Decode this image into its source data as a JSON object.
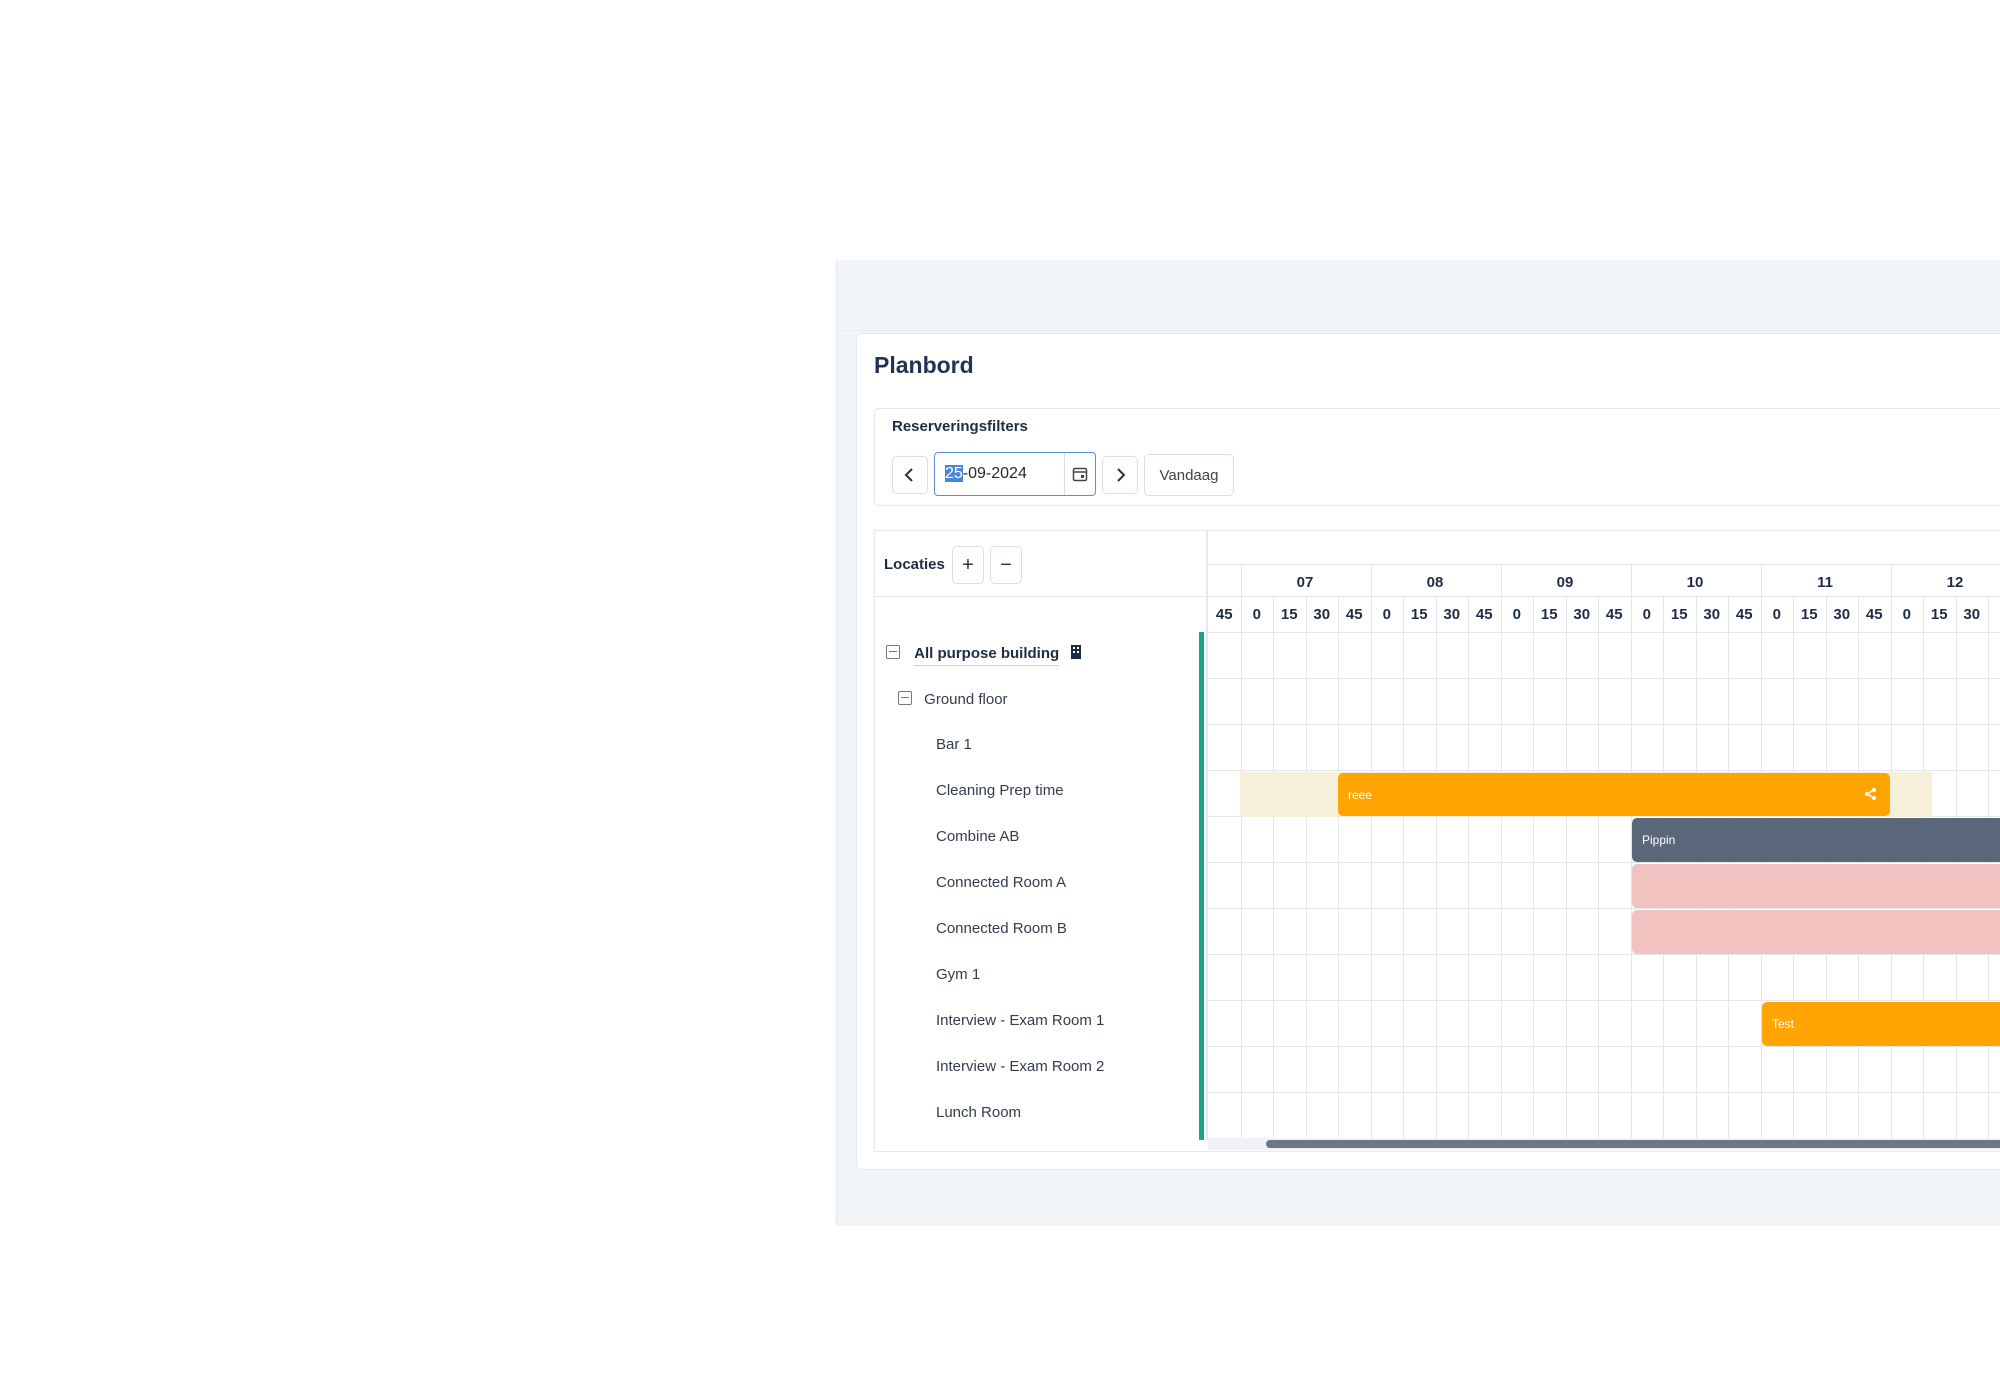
{
  "page": {
    "title": "Planbord"
  },
  "filters": {
    "label": "Reserveringsfilters",
    "date_selected_part": "25",
    "date_rest": "-09-2024",
    "today_label": "Vandaag"
  },
  "locations": {
    "header": "Locaties",
    "expand_label": "+",
    "collapse_label": "−",
    "building": "All purpose building",
    "floor": "Ground floor",
    "rooms": [
      "Bar 1",
      "Cleaning Prep time",
      "Combine AB",
      "Connected Room A",
      "Connected Room B",
      "Gym 1",
      "Interview - Exam Room 1",
      "Interview - Exam Room 2",
      "Lunch Room"
    ]
  },
  "timeline": {
    "hours": [
      "07",
      "08",
      "09",
      "10",
      "11",
      "12"
    ],
    "quarters": [
      "45",
      "0",
      "15",
      "30",
      "45",
      "0",
      "15",
      "30",
      "45",
      "0",
      "15",
      "30",
      "45",
      "0",
      "15",
      "30",
      "45",
      "0",
      "15",
      "30",
      "45",
      "0",
      "15",
      "30"
    ]
  },
  "events": {
    "reee": "reee",
    "pippin": "Pippin",
    "test": "Test"
  },
  "colors": {
    "accent": "#1aa58b",
    "event_orange": "#ffa400",
    "event_slate": "#5a6679",
    "event_pink": "#f2c2c0",
    "prep_beige": "#f6efd9"
  }
}
